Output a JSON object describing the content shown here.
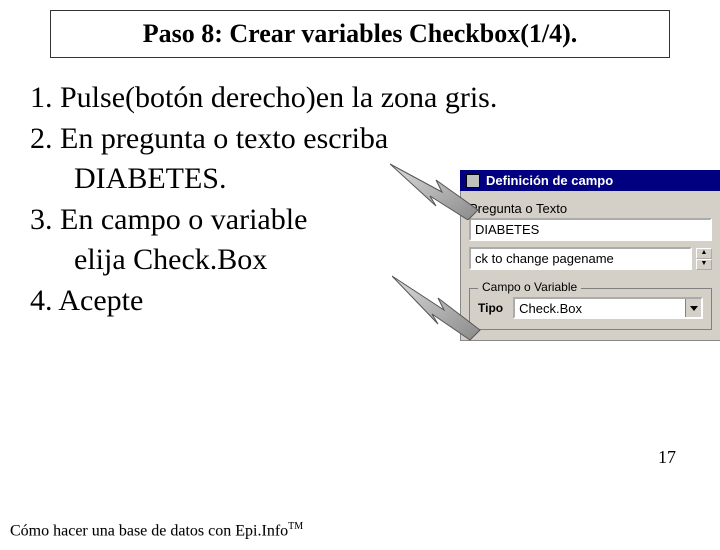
{
  "title": "Paso 8: Crear variables Checkbox(1/4).",
  "steps": {
    "s1": "1. Pulse(botón derecho)en la zona gris.",
    "s2": "2. En pregunta o texto escriba",
    "s2b": "DIABETES.",
    "s3": "3. En campo o variable",
    "s3b": "elija Check.Box",
    "s4": "4. Acepte"
  },
  "dialog": {
    "title": "Definición de campo",
    "question_label": "Pregunta o Texto",
    "question_value": "DIABETES",
    "pagename_value": "ck to change pagename",
    "fieldset_legend": "Campo o Variable",
    "tipo_label": "Tipo",
    "tipo_value": "Check.Box"
  },
  "footer": {
    "text_a": "Cómo hacer una base de datos con ",
    "text_b": "Epi.Info",
    "tm": "TM"
  },
  "page_number": "17"
}
